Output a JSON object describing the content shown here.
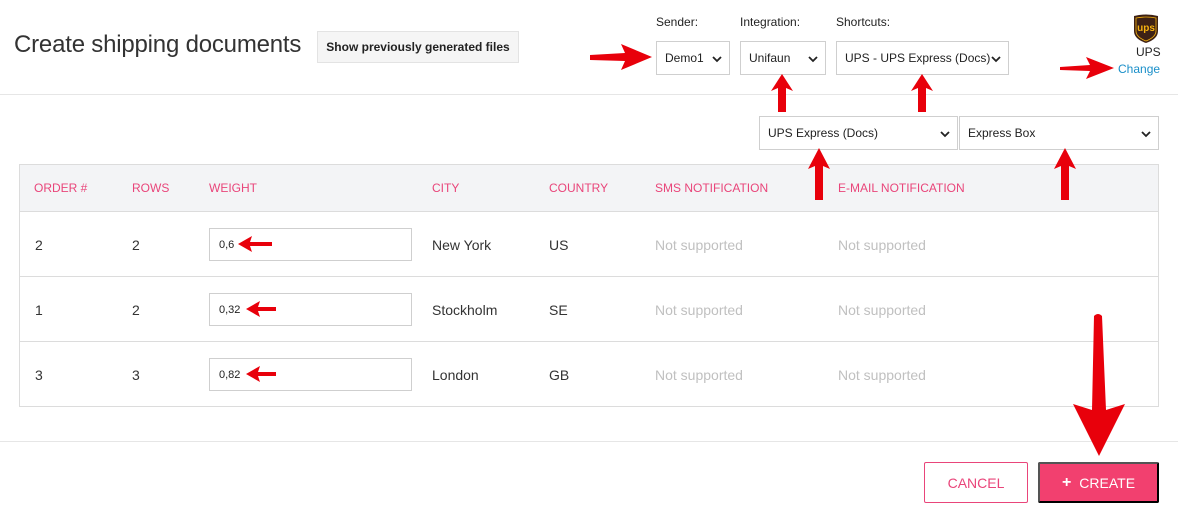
{
  "header": {
    "title": "Create shipping documents",
    "show_files_label": "Show previously generated files"
  },
  "selectors": {
    "sender": {
      "label": "Sender:",
      "value": "Demo1"
    },
    "integration": {
      "label": "Integration:",
      "value": "Unifaun"
    },
    "shortcuts": {
      "label": "Shortcuts:",
      "value": "UPS - UPS Express (Docs)"
    },
    "service": {
      "value": "UPS Express (Docs)"
    },
    "package": {
      "value": "Express Box"
    }
  },
  "carrier": {
    "name": "UPS",
    "change_label": "Change",
    "logo_text": "ups",
    "logo_color": "#3d2115",
    "logo_accent": "#f6b20f"
  },
  "table": {
    "headers": [
      "Order #",
      "Rows",
      "Weight",
      "City",
      "Country",
      "SMS notification",
      "E-mail notification"
    ],
    "rows": [
      {
        "order": "2",
        "rows": "2",
        "weight": "0,6",
        "city": "New York",
        "country": "US",
        "sms": "Not supported",
        "email": "Not supported"
      },
      {
        "order": "1",
        "rows": "2",
        "weight": "0,32",
        "city": "Stockholm",
        "country": "SE",
        "sms": "Not supported",
        "email": "Not supported"
      },
      {
        "order": "3",
        "rows": "3",
        "weight": "0,82",
        "city": "London",
        "country": "GB",
        "sms": "Not supported",
        "email": "Not supported"
      }
    ]
  },
  "footer": {
    "cancel_label": "CANCEL",
    "create_label": "CREATE"
  },
  "colors": {
    "accent": "#f2406f",
    "header_text": "#e9457a",
    "link": "#1a8fc9",
    "annotation_arrow": "#e8000b"
  }
}
